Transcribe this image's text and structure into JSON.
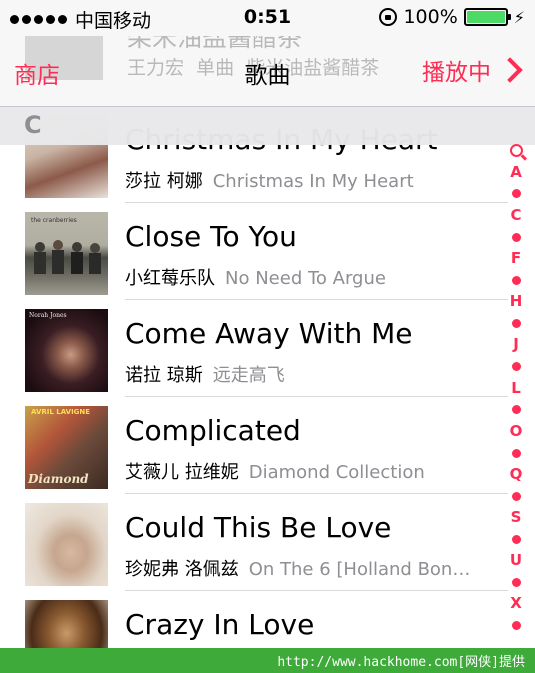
{
  "status_bar": {
    "carrier": "中国移动",
    "time": "0:51",
    "battery": "100%",
    "battery_level": 1.0,
    "signal_icon": "signal-dots-icon",
    "lock_icon": "rotation-lock-icon",
    "charging_icon": "bolt-icon"
  },
  "nav": {
    "store_label": "商店",
    "title": "歌曲",
    "now_playing_label": "播放中",
    "now_playing_song": "柴米油盐酱醋茶",
    "now_playing_artist": "王力宏",
    "now_playing_album": "柴米油盐酱醋茶",
    "now_playing_sep": "单曲",
    "chevron_icon": "chevron-right-icon"
  },
  "section_letter": "C",
  "songs": [
    {
      "title": "Christmas In My Heart",
      "artist": "莎拉 柯娜",
      "album": "Christmas In My Heart"
    },
    {
      "title": "Close To You",
      "artist": "小红莓乐队",
      "album": "No Need To Argue"
    },
    {
      "title": "Come Away With Me",
      "artist": "诺拉 琼斯",
      "album": "远走高飞"
    },
    {
      "title": "Complicated",
      "artist": "艾薇儿 拉维妮",
      "album": "Diamond Collection"
    },
    {
      "title": "Could This Be Love",
      "artist": "珍妮弗 洛佩兹",
      "album": "On The 6 [Holland Bon…"
    },
    {
      "title": "Crazy In Love",
      "artist": "",
      "album": ""
    }
  ],
  "artwork_text": {
    "art_2_text": "the cranberries",
    "art_3_text": "Norah Jones",
    "art_4_text_top": "AVRIL LAVIGNE",
    "art_4_text_bottom": "Diamond"
  },
  "index": [
    "search",
    "A",
    "•",
    "C",
    "•",
    "F",
    "•",
    "H",
    "•",
    "J",
    "•",
    "L",
    "•",
    "O",
    "•",
    "Q",
    "•",
    "S",
    "•",
    "U",
    "•",
    "X",
    "•"
  ],
  "footer_text": "http://www.hackhome.com[网侠]提供",
  "colors": {
    "accent": "#ff2d55",
    "footer": "#3daa3a",
    "battery": "#4cd964"
  }
}
